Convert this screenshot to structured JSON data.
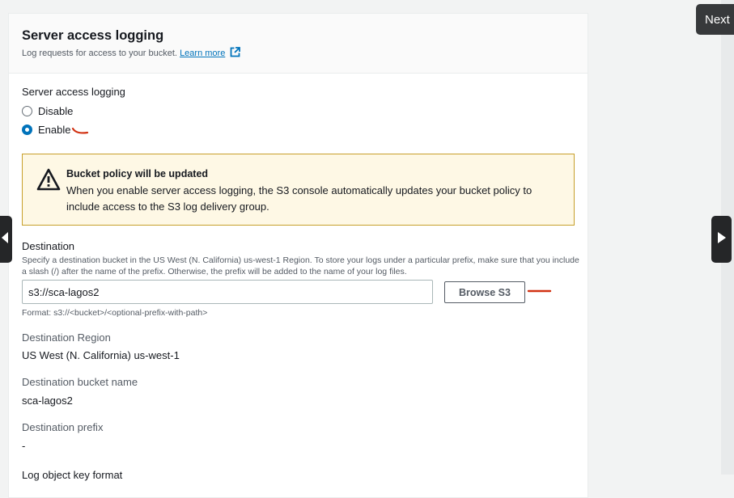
{
  "section": {
    "title": "Server access logging",
    "description": "Log requests for access to your bucket.",
    "learn_more": "Learn more"
  },
  "logging": {
    "label": "Server access logging",
    "options": [
      {
        "label": "Disable",
        "selected": false
      },
      {
        "label": "Enable",
        "selected": true
      }
    ]
  },
  "alert": {
    "title": "Bucket policy will be updated",
    "body": "When you enable server access logging, the S3 console automatically updates your bucket policy to include access to the S3 log delivery group."
  },
  "destination": {
    "label": "Destination",
    "help": "Specify a destination bucket in the US West (N. California) us-west-1 Region. To store your logs under a particular prefix, make sure that you include a slash (/) after the name of the prefix. Otherwise, the prefix will be added to the name of your log files.",
    "value": "s3://sca-lagos2",
    "browse_label": "Browse S3",
    "format_hint": "Format: s3://<bucket>/<optional-prefix-with-path>"
  },
  "details": [
    {
      "label": "Destination Region",
      "value": "US West (N. California) us-west-1"
    },
    {
      "label": "Destination bucket name",
      "value": "sca-lagos2"
    },
    {
      "label": "Destination prefix",
      "value": "-"
    }
  ],
  "cut_off_label": "Log object key format",
  "overlay": {
    "next_label": "Next"
  },
  "colors": {
    "accent": "#0073bb",
    "warning_bg": "#fef8e5",
    "warning_border": "#c79f2a",
    "annotation": "#d13212"
  }
}
